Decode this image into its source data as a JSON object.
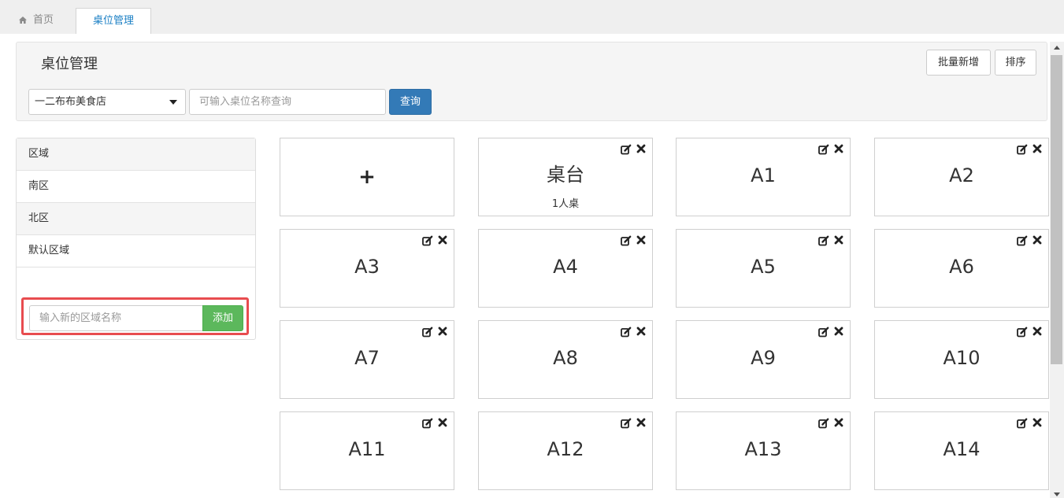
{
  "tabs": [
    {
      "label": "首页",
      "icon": "home-icon"
    },
    {
      "label": "桌位管理",
      "active": true
    }
  ],
  "header": {
    "title": "桌位管理",
    "batch_add_label": "批量新增",
    "sort_label": "排序",
    "store_select_value": "一二布布美食店",
    "search_placeholder": "可输入桌位名称查询",
    "query_label": "查询"
  },
  "areas": {
    "items": [
      "区域",
      "南区",
      "北区",
      "默认区域"
    ],
    "new_area_placeholder": "输入新的区域名称",
    "add_label": "添加"
  },
  "tables": {
    "add_symbol": "+",
    "items": [
      {
        "name": "桌台",
        "sub": "1人桌"
      },
      {
        "name": "A1"
      },
      {
        "name": "A2"
      },
      {
        "name": "A3"
      },
      {
        "name": "A4"
      },
      {
        "name": "A5"
      },
      {
        "name": "A6"
      },
      {
        "name": "A7"
      },
      {
        "name": "A8"
      },
      {
        "name": "A9"
      },
      {
        "name": "A10"
      },
      {
        "name": "A11"
      },
      {
        "name": "A12"
      },
      {
        "name": "A13"
      },
      {
        "name": "A14"
      }
    ]
  },
  "colors": {
    "primary": "#337ab7",
    "success": "#5cb85c",
    "highlight": "#e84c4f",
    "active_tab": "#1a7fc4"
  }
}
